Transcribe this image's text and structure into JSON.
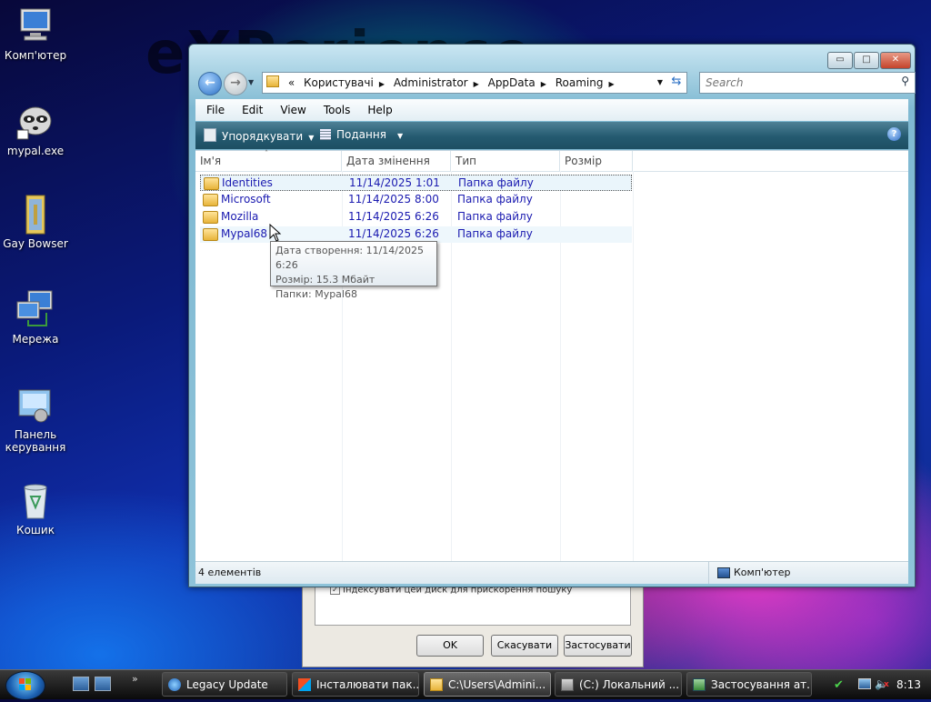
{
  "desktop": {
    "watermark": "eXPerience",
    "icons": [
      {
        "label": "Комп'ютер",
        "icon": "computer-icon"
      },
      {
        "label": "mypal.exe",
        "icon": "mypal-raccoon-icon"
      },
      {
        "label": "Gay Bowser",
        "icon": "folder-icon"
      },
      {
        "label": "Мережа",
        "icon": "network-icon"
      },
      {
        "label": "Панель керування",
        "icon": "control-panel-icon"
      },
      {
        "label": "Кошик",
        "icon": "recycle-bin-icon"
      }
    ]
  },
  "background_dialog": {
    "checkbox_label": "Індексувати цей диск для прискорення пошуку",
    "ok": "OK",
    "cancel": "Скасувати",
    "apply": "Застосувати"
  },
  "explorer": {
    "window_controls": {
      "minimize": "▭",
      "maximize": "□",
      "close": "✕"
    },
    "address": {
      "prefix": "«",
      "segments": [
        "Користувачі",
        "Administrator",
        "AppData",
        "Roaming"
      ]
    },
    "search_placeholder": "Search",
    "menu": [
      "File",
      "Edit",
      "View",
      "Tools",
      "Help"
    ],
    "toolbar": {
      "organize": "Упорядкувати",
      "views": "Подання"
    },
    "columns": [
      "Ім'я",
      "Дата змінення",
      "Тип",
      "Розмір"
    ],
    "rows": [
      {
        "name": "Identities",
        "date": "11/14/2025 1:01",
        "type": "Папка файлу",
        "size": ""
      },
      {
        "name": "Microsoft",
        "date": "11/14/2025 8:00",
        "type": "Папка файлу",
        "size": ""
      },
      {
        "name": "Mozilla",
        "date": "11/14/2025 6:26",
        "type": "Папка файлу",
        "size": ""
      },
      {
        "name": "Mypal68",
        "date": "11/14/2025 6:26",
        "type": "Папка файлу",
        "size": ""
      }
    ],
    "tooltip": {
      "created": "Дата створення: 11/14/2025 6:26",
      "size": "Розмір: 15.3 Мбайт",
      "folders": "Папки: Mypal68"
    },
    "status": {
      "count": "4 елементів",
      "location": "Комп'ютер"
    }
  },
  "taskbar": {
    "buttons": [
      {
        "label": "Legacy Update",
        "icon": "legacy-update-icon"
      },
      {
        "label": "Інсталювати пак...",
        "icon": "install-icon"
      },
      {
        "label": "C:\\Users\\Admini...",
        "icon": "folder-icon"
      },
      {
        "label": "(C:) Локальний ...",
        "icon": "drive-icon"
      },
      {
        "label": "Застосування ат...",
        "icon": "apply-attributes-icon"
      }
    ],
    "clock": "8:13"
  }
}
